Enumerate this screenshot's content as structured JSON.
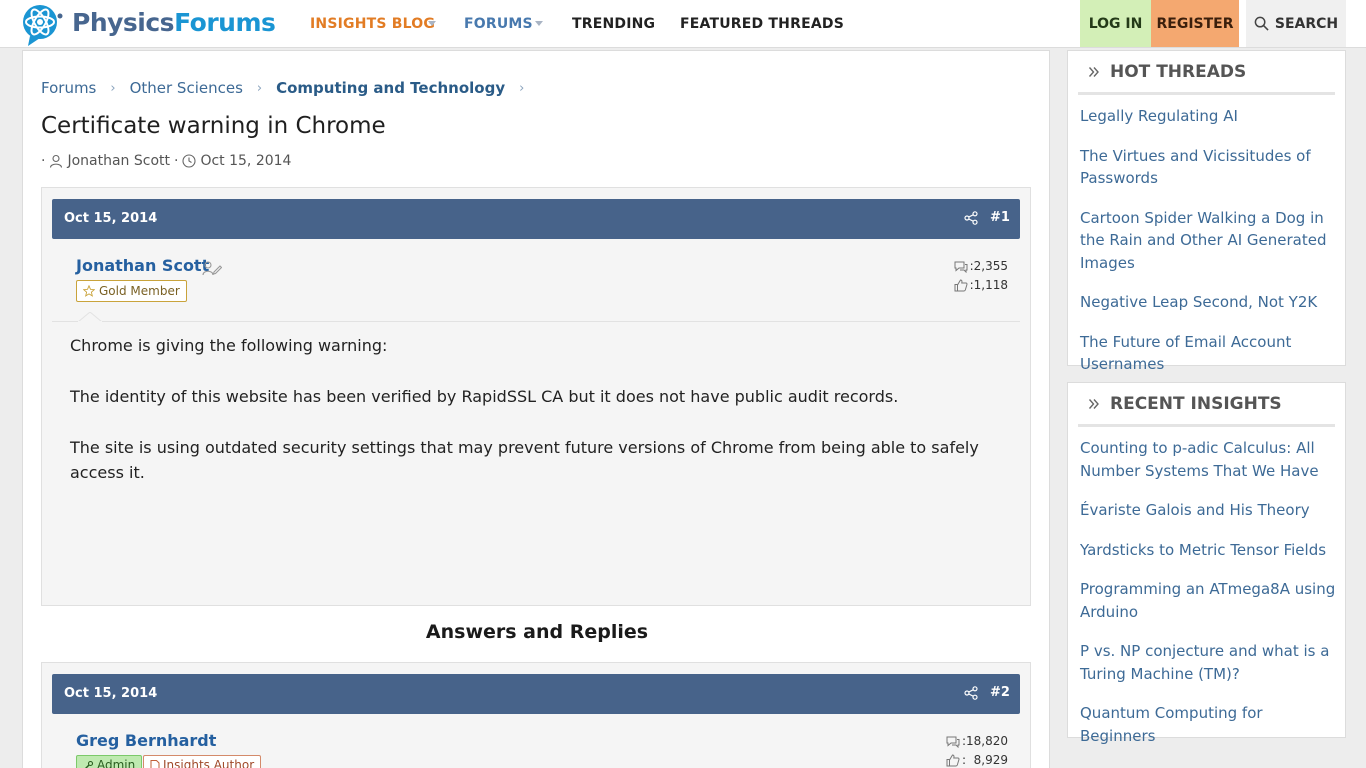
{
  "header": {
    "logo": {
      "part1": "Physics",
      "part2": "Forums"
    },
    "nav": {
      "insights_blog": "INSIGHTS BLOG",
      "forums": "FORUMS",
      "trending": "TRENDING",
      "featured_threads": "FEATURED THREADS"
    },
    "login": "LOG IN",
    "register": "REGISTER",
    "search": "SEARCH"
  },
  "breadcrumb": [
    "Forums",
    "Other Sciences",
    "Computing and Technology"
  ],
  "thread": {
    "title": "Certificate warning in Chrome",
    "author": "Jonathan Scott",
    "date": "Oct 15, 2014"
  },
  "posts": [
    {
      "date": "Oct 15, 2014",
      "number": "#1",
      "author": "Jonathan Scott",
      "badge": "Gold Member",
      "messages": ":2,355",
      "reactions": ":1,118",
      "body": [
        "Chrome is giving the following warning:",
        "The identity of this website has been verified by RapidSSL CA but it does not have public audit records.",
        "The site is using outdated security settings that may prevent future versions of Chrome from being able to safely access it."
      ]
    },
    {
      "date": "Oct 15, 2014",
      "number": "#2",
      "author": "Greg Bernhardt",
      "badges": [
        "Admin",
        "Insights Author"
      ],
      "messages": ":18,820",
      "reactions": ":  8,929"
    }
  ],
  "answers_heading": "Answers and Replies",
  "sidebar": {
    "hot_threads": {
      "title": "HOT THREADS",
      "items": [
        "Legally Regulating AI",
        "The Virtues and Vicissitudes of Passwords",
        "Cartoon Spider Walking a Dog in the Rain and Other AI Generated Images",
        "Negative Leap Second, Not Y2K",
        "The Future of Email Account Usernames"
      ]
    },
    "recent_insights": {
      "title": "RECENT INSIGHTS",
      "items": [
        " Counting to p-adic Calculus: All Number Systems That We Have",
        " Évariste Galois and His Theory",
        " Yardsticks to Metric Tensor Fields",
        " Programming an ATmega8A using Arduino",
        " P vs. NP conjecture and what is a Turing Machine (TM)?",
        " Quantum Computing for Beginners"
      ]
    }
  },
  "colors": {
    "post_header": "#47638a",
    "link": "#3d6a96",
    "login_bg": "#d3efb7",
    "register_bg": "#f4a870",
    "insights_nav": "#e27c24"
  }
}
